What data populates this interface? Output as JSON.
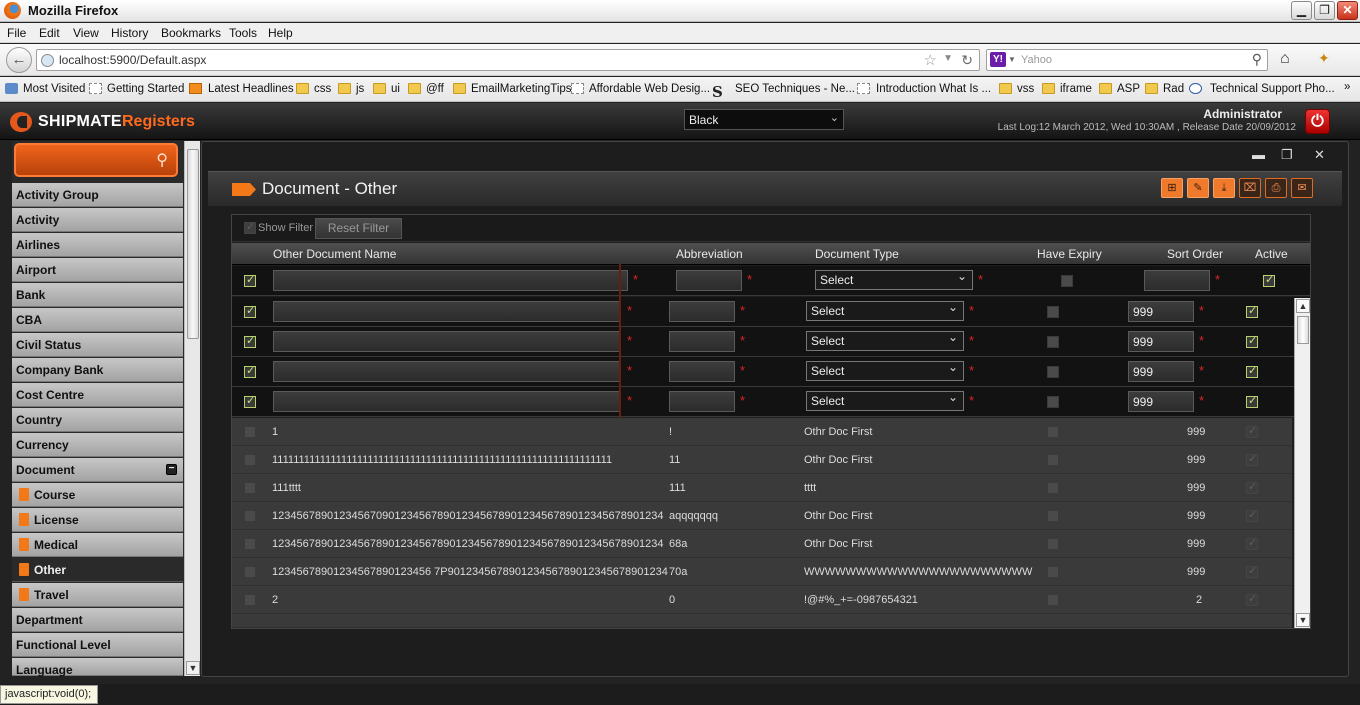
{
  "window": {
    "title": "Mozilla Firefox"
  },
  "menu": [
    "File",
    "Edit",
    "View",
    "History",
    "Bookmarks",
    "Tools",
    "Help"
  ],
  "nav": {
    "url": "localhost:5900/Default.aspx",
    "search_placeholder": "Yahoo"
  },
  "bookmarks": [
    "Most Visited",
    "Getting Started",
    "Latest Headlines",
    "css",
    "js",
    "ui",
    "@ff",
    "EmailMarketingTips",
    "Affordable Web Desig...",
    "SEO Techniques - Ne...",
    "Introduction What Is ...",
    "vss",
    "iframe",
    "ASP",
    "Rad",
    "Technical Support Pho..."
  ],
  "app": {
    "logo_main": "SHIPMATE",
    "logo_sub": "Registers",
    "theme": "Black",
    "user": "Administrator",
    "last_log": "Last Log:12 March 2012, Wed 10:30AM , Release Date 20/09/2012"
  },
  "sidebar": {
    "items": [
      "Activity Group",
      "Activity",
      "Airlines",
      "Airport",
      "Bank",
      "CBA",
      "Civil Status",
      "Company Bank",
      "Cost Centre",
      "Country",
      "Currency",
      "Document"
    ],
    "subitems": [
      "Course",
      "License",
      "Medical",
      "Other",
      "Travel"
    ],
    "after": [
      "Department",
      "Functional Level",
      "Language"
    ]
  },
  "page": {
    "title": "Document - Other",
    "show_filter": "Show Filter",
    "reset_filter": "Reset Filter"
  },
  "grid": {
    "headers": [
      "Other Document Name",
      "Abbreviation",
      "Document Type",
      "Have Expiry",
      "Sort Order",
      "Active"
    ],
    "select_label": "Select",
    "default_sort": "999",
    "rows": [
      {
        "name": "1",
        "abbr": "!",
        "type": "Othr Doc First",
        "sort": "999"
      },
      {
        "name": "1111111111111111111111111111111111111111111111111111111111111111",
        "abbr": "11",
        "type": "Othr Doc First",
        "sort": "999"
      },
      {
        "name": "111tttt",
        "abbr": "111",
        "type": "tttt",
        "sort": "999"
      },
      {
        "name": "1234567890123456709012345678901234567890123456789012345678901234",
        "abbr": "aqqqqqqq",
        "type": "Othr Doc First",
        "sort": "999"
      },
      {
        "name": "1234567890123456789012345678901234567890123456789012345678901234",
        "abbr": "68a",
        "type": "Othr Doc First",
        "sort": "999"
      },
      {
        "name": "12345678901234567890123456 7P901234567890123456789012345678901234",
        "abbr": "70a",
        "type": "WWWWWWWWWWWWWWWWWWWWWW",
        "sort": "999"
      },
      {
        "name": "2",
        "abbr": "0",
        "type": "!@#%_+=-0987654321",
        "sort": "2"
      }
    ]
  },
  "status": "javascript:void(0);"
}
